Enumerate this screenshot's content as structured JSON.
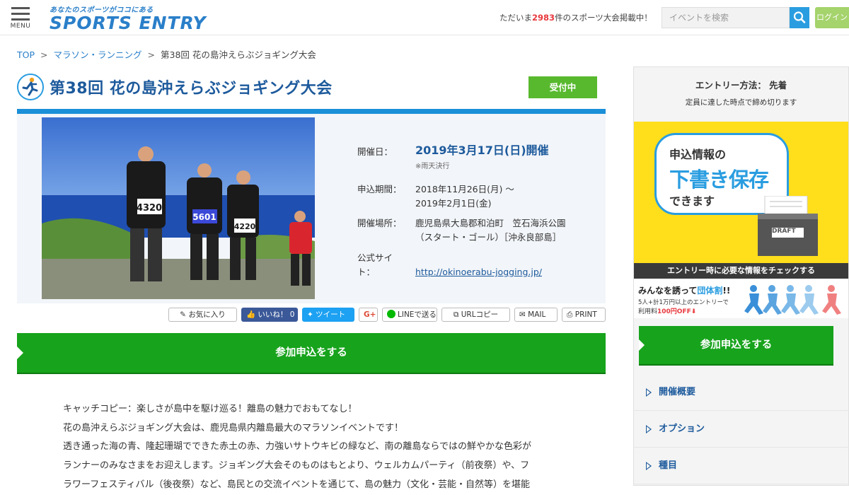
{
  "header": {
    "menu_label": "MENU",
    "tagline": "あなたのスポーツがココにある",
    "brand": "SPORTS ENTRY",
    "count_prefix": "ただいま",
    "count_number": "2983",
    "count_suffix": "件のスポーツ大会掲載中！",
    "search_placeholder": "イベントを検索",
    "login_label": "ログイン",
    "accent_color": "#2a9de0"
  },
  "breadcrumb": {
    "items": [
      "TOP",
      "マラソン・ランニング",
      "第38回 花の島沖えらぶジョギング大会"
    ],
    "separator": ">"
  },
  "event": {
    "title": "第38回 花の島沖えらぶジョギング大会",
    "status": "受付中",
    "info": {
      "date_label": "開催日：",
      "date_value": "2019年3月17日(日)開催",
      "rain_note": "※雨天決行",
      "period_label": "申込期間：",
      "period_value_1": "2018年11月26日(月) ～",
      "period_value_2": "2019年2月1日(金)",
      "venue_label": "開催場所：",
      "venue_value_1": "鹿児島県大島郡和泊町　笠石海浜公園",
      "venue_value_2": "（スタート・ゴール）［沖永良部島］",
      "site_label_1": "公式サイ",
      "site_label_2": "ト：",
      "site_url": "http://okinoerabu-jogging.jp/"
    },
    "photo": {
      "runner_numbers": [
        "4320",
        "5601",
        "4220"
      ]
    }
  },
  "share": {
    "favorite": "お気に入り",
    "like": "いいね！",
    "like_count": "0",
    "tweet": "ツイート",
    "gplus": "G+",
    "line": "LINEで送る",
    "url_copy": "URLコピー",
    "mail": "MAIL",
    "print": "PRINT"
  },
  "apply_label": "参加申込をする",
  "description": [
    "キャッチコピー：楽しさが島中を駆け巡る！離島の魅力でおもてなし！",
    "花の島沖えらぶジョギング大会は、鹿児島県内離島最大のマラソンイベントです！",
    "透き通った海の青、隆起珊瑚でできた赤土の赤、力強いサトウキビの緑など、南の離島ならではの鮮やかな色彩が",
    "ランナーのみなさまをお迎えします。ジョギング大会そのものはもとより、ウェルカムパーティ（前夜祭）や、フ",
    "ラワーフェスティバル（後夜祭）など、島民との交流イベントを通じて、島の魅力（文化・芸能・自然等）を堪能"
  ],
  "sidebar": {
    "entry_method": "エントリー方法： 先着",
    "entry_note": "定員に達した時点で締め切ります",
    "draft_banner": {
      "line1": "申込情報の",
      "line2": "下書き保存",
      "line3": "できます",
      "box_label": "DRAFT",
      "bottom": "エントリー時に必要な情報をチェックする"
    },
    "group_banner": {
      "line1_a": "みんなを誘って",
      "line1_b": "団体割",
      "line1_c": "!!",
      "line2": "5人+計1万円以上のエントリーで",
      "line3_a": "利用料",
      "line3_b": "100円OFF",
      "line3_c": "⬇"
    },
    "apply_label": "参加申込をする",
    "nav": [
      "開催概要",
      "オプション",
      "種目"
    ]
  }
}
